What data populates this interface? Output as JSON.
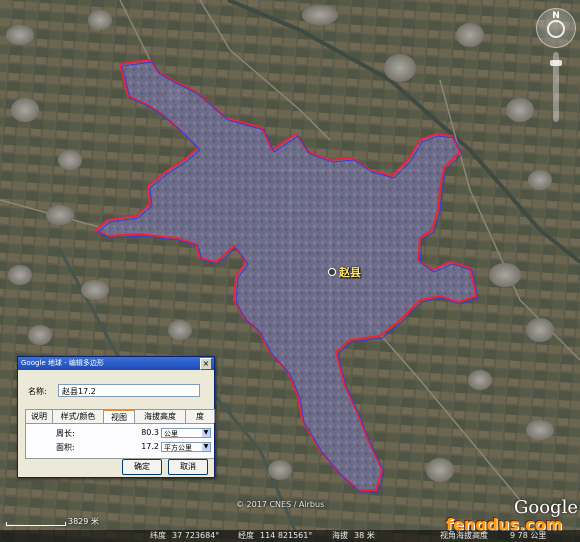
{
  "map": {
    "place_label": "赵县",
    "copyright": "© 2017 CNES / Airbus",
    "scale_label": "3829 米",
    "google_logo": "Google",
    "watermark": "fengdus.com",
    "compass_north": "N"
  },
  "statusbar": {
    "lat_label": "纬度",
    "lat_value": "37 723684°",
    "lon_label": "经度",
    "lon_value": "114 821561°",
    "elev_label": "海拔",
    "elev_value": "38 米",
    "eye_label": "视角海拔高度",
    "eye_value": "9 78 公里"
  },
  "dialog": {
    "title": "Google 地球 - 编辑多边形",
    "close_label": "×",
    "name_label": "名称:",
    "name_value": "赵县17.2",
    "tabs": [
      "说明",
      "样式/颜色",
      "视图",
      "海拔高度",
      "度"
    ],
    "perimeter_label": "周长:",
    "perimeter_value": "80.3",
    "perimeter_unit": "公里",
    "area_label": "面积:",
    "area_value": "17.2",
    "area_unit": "平方公里",
    "ok_label": "确定",
    "cancel_label": "取消"
  }
}
